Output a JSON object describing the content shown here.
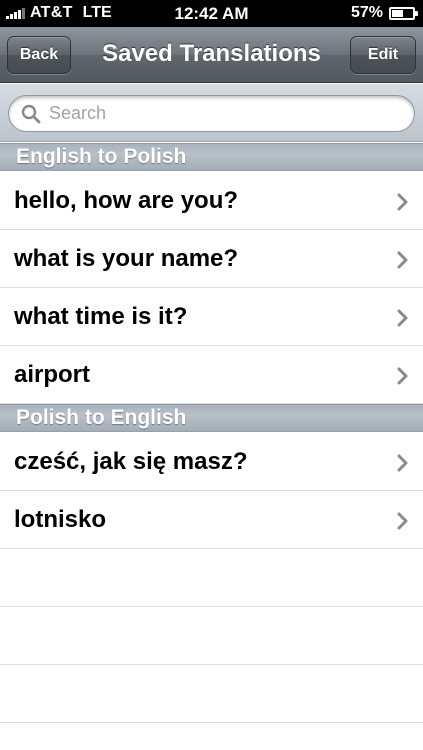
{
  "status_bar": {
    "carrier": "AT&T",
    "network": "LTE",
    "time": "12:42 AM",
    "battery": "57%",
    "battery_level": 0.57
  },
  "nav": {
    "back_label": "Back",
    "title": "Saved Translations",
    "edit_label": "Edit"
  },
  "search": {
    "placeholder": "Search",
    "value": ""
  },
  "sections": [
    {
      "title": "English to Polish",
      "items": [
        "hello, how are you?",
        "what is your name?",
        "what time is it?",
        "airport"
      ]
    },
    {
      "title": "Polish to English",
      "items": [
        "cześć, jak się masz?",
        "lotnisko"
      ]
    }
  ],
  "colors": {
    "nav_bar": "#6d747b",
    "section_header": "#b0b9c2",
    "chevron": "#8a8a8a"
  },
  "icons": {
    "search": "search-icon",
    "chevron": "chevron-right-icon"
  }
}
